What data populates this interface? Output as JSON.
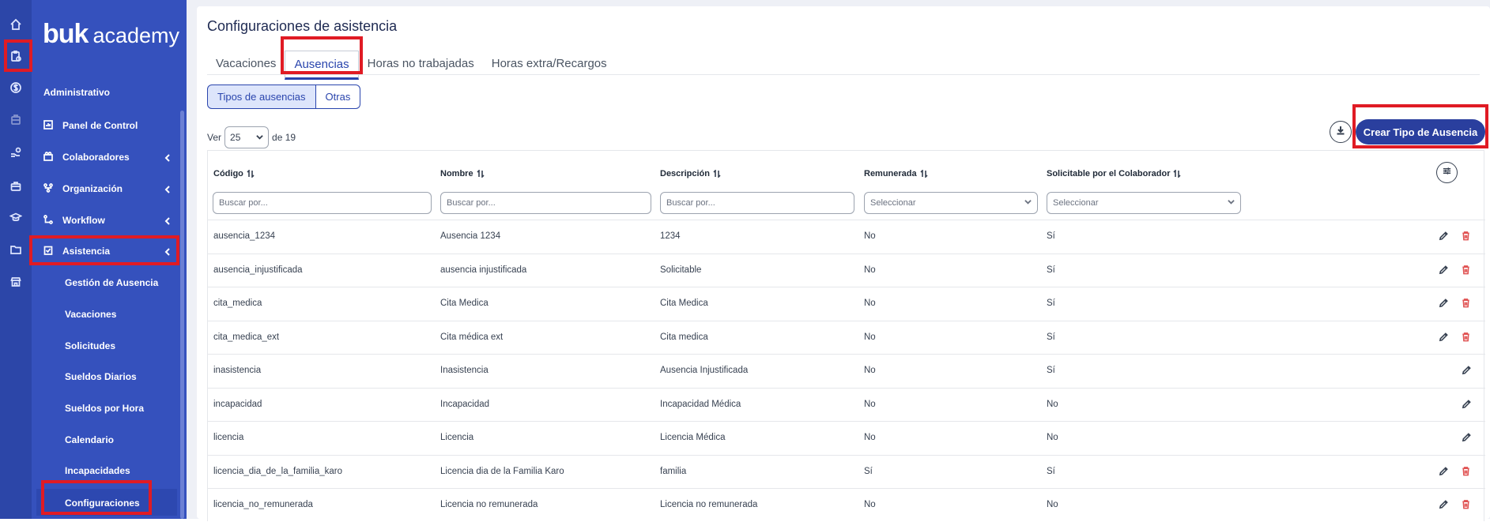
{
  "logo": {
    "brand": "buk",
    "suffix": "academy"
  },
  "sidebar": {
    "section_title": "Administrativo",
    "items": [
      {
        "label": "Panel de Control",
        "icon": "dashboard-icon",
        "has_chevron": false
      },
      {
        "label": "Colaboradores",
        "icon": "people-icon",
        "has_chevron": true
      },
      {
        "label": "Organización",
        "icon": "org-chart-icon",
        "has_chevron": true
      },
      {
        "label": "Workflow",
        "icon": "workflow-icon",
        "has_chevron": true
      },
      {
        "label": "Asistencia",
        "icon": "clipboard-check-icon",
        "has_chevron": true
      }
    ],
    "subitems": [
      "Gestión de Ausencia",
      "Vacaciones",
      "Solicitudes",
      "Sueldos Diarios",
      "Sueldos por Hora",
      "Calendario",
      "Incapacidades",
      "Configuraciones"
    ]
  },
  "page": {
    "title": "Configuraciones de asistencia",
    "tabs": [
      "Vacaciones",
      "Ausencias",
      "Horas no trabajadas",
      "Horas extra/Recargos"
    ],
    "active_tab": "Ausencias",
    "segments": [
      "Tipos de ausencias",
      "Otras"
    ],
    "pager": {
      "ver_label": "Ver",
      "page_size": "25",
      "total_label": "de 19"
    },
    "create_button": "Crear Tipo de Ausencia"
  },
  "table": {
    "columns": [
      "Código",
      "Nombre",
      "Descripción",
      "Remunerada",
      "Solicitable por el Colaborador"
    ],
    "filters": [
      "Buscar por...",
      "Buscar por...",
      "Buscar por...",
      "Seleccionar",
      "Seleccionar"
    ],
    "rows": [
      {
        "codigo": "ausencia_1234",
        "nombre": "Ausencia 1234",
        "descripcion": "1234",
        "remunerada": "No",
        "solicitable": "Sí",
        "deletable": true
      },
      {
        "codigo": "ausencia_injustificada",
        "nombre": "ausencia injustificada",
        "descripcion": "Solicitable",
        "remunerada": "No",
        "solicitable": "Sí",
        "deletable": true
      },
      {
        "codigo": "cita_medica",
        "nombre": "Cita Medica",
        "descripcion": "Cita Medica",
        "remunerada": "No",
        "solicitable": "Sí",
        "deletable": true
      },
      {
        "codigo": "cita_medica_ext",
        "nombre": "Cita médica ext",
        "descripcion": "Cita medica",
        "remunerada": "No",
        "solicitable": "Sí",
        "deletable": true
      },
      {
        "codigo": "inasistencia",
        "nombre": "Inasistencia",
        "descripcion": "Ausencia Injustificada",
        "remunerada": "No",
        "solicitable": "Sí",
        "deletable": false
      },
      {
        "codigo": "incapacidad",
        "nombre": "Incapacidad",
        "descripcion": "Incapacidad Médica",
        "remunerada": "No",
        "solicitable": "No",
        "deletable": false
      },
      {
        "codigo": "licencia",
        "nombre": "Licencia",
        "descripcion": "Licencia Médica",
        "remunerada": "No",
        "solicitable": "No",
        "deletable": false
      },
      {
        "codigo": "licencia_dia_de_la_familia_karo",
        "nombre": "Licencia dia de la Familia Karo",
        "descripcion": "familia",
        "remunerada": "Sí",
        "solicitable": "Sí",
        "deletable": true
      },
      {
        "codigo": "licencia_no_remunerada",
        "nombre": "Licencia no remunerada",
        "descripcion": "Licencia no remunerada",
        "remunerada": "No",
        "solicitable": "No",
        "deletable": true
      }
    ]
  },
  "colors": {
    "sidebar": "#3551bd",
    "rail": "#2c46a8",
    "accent": "#2a45ad",
    "highlight": "#e01b24",
    "delete": "#e05252"
  }
}
